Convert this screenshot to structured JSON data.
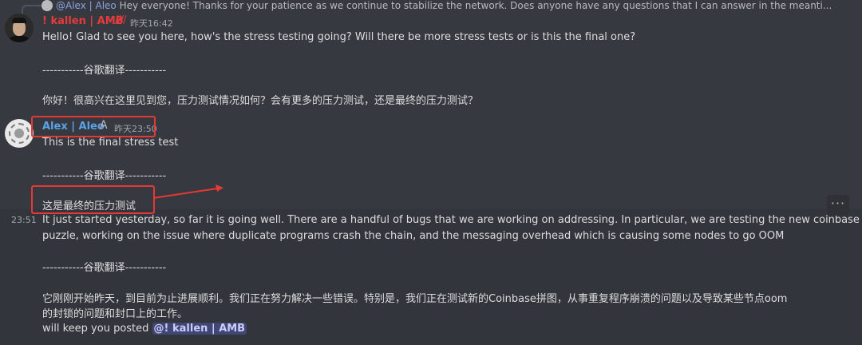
{
  "reply": {
    "mention": "@Alex | Aleo",
    "text": "Hey everyone! Thanks for your patience as we continue to stabilize the network. Does anyone have any questions that I can answer in the meanti..."
  },
  "messages": [
    {
      "author": "! kallen | AMB",
      "badge": "////",
      "timestamp": "昨天16:42",
      "line1": "Hello! Glad to see you here, how's the stress testing going? Will there be more stress tests or is this the final one?",
      "separator": "-----------谷歌翻译-----------",
      "translation": "你好！很高兴在这里见到您，压力测试情况如何？会有更多的压力测试，还是最终的压力测试？"
    },
    {
      "author": "Alex | Aleo",
      "badge": "A",
      "timestamp": "昨天23:50",
      "line1": "This is the final stress test",
      "separator": "-----------谷歌翻译-----------",
      "translation": "这是最终的压力测试"
    },
    {
      "hover_timestamp": "23:51",
      "line1": "It just started yesterday, so far it is going well. There are a handful of bugs that we are working on addressing. In particular, we are testing the new coinbase",
      "line2": "puzzle, working on the issue where duplicate programs crash the chain, and the messaging overhead which is causing some nodes to go OOM",
      "separator": "-----------谷歌翻译-----------",
      "translation1": "它刚刚开始昨天，到目前为止进展顺利。我们正在努力解决一些错误。特别是，我们正在测试新的Coinbase拼图，从事重复程序崩溃的问题以及导致某些节点oom",
      "translation2": "的封锁的问题和封口上的工作。",
      "followup_text": "will keep you posted",
      "followup_mention": "@! kallen | AMB"
    }
  ],
  "actions": {
    "more_icon": "more-horizontal-icon",
    "more_label": "···"
  },
  "colors": {
    "background": "#36393f",
    "kallen_name": "#e63b3b",
    "alex_name": "#5aa2e8",
    "annotation": "#e53935",
    "mention_bg": "#414675"
  }
}
